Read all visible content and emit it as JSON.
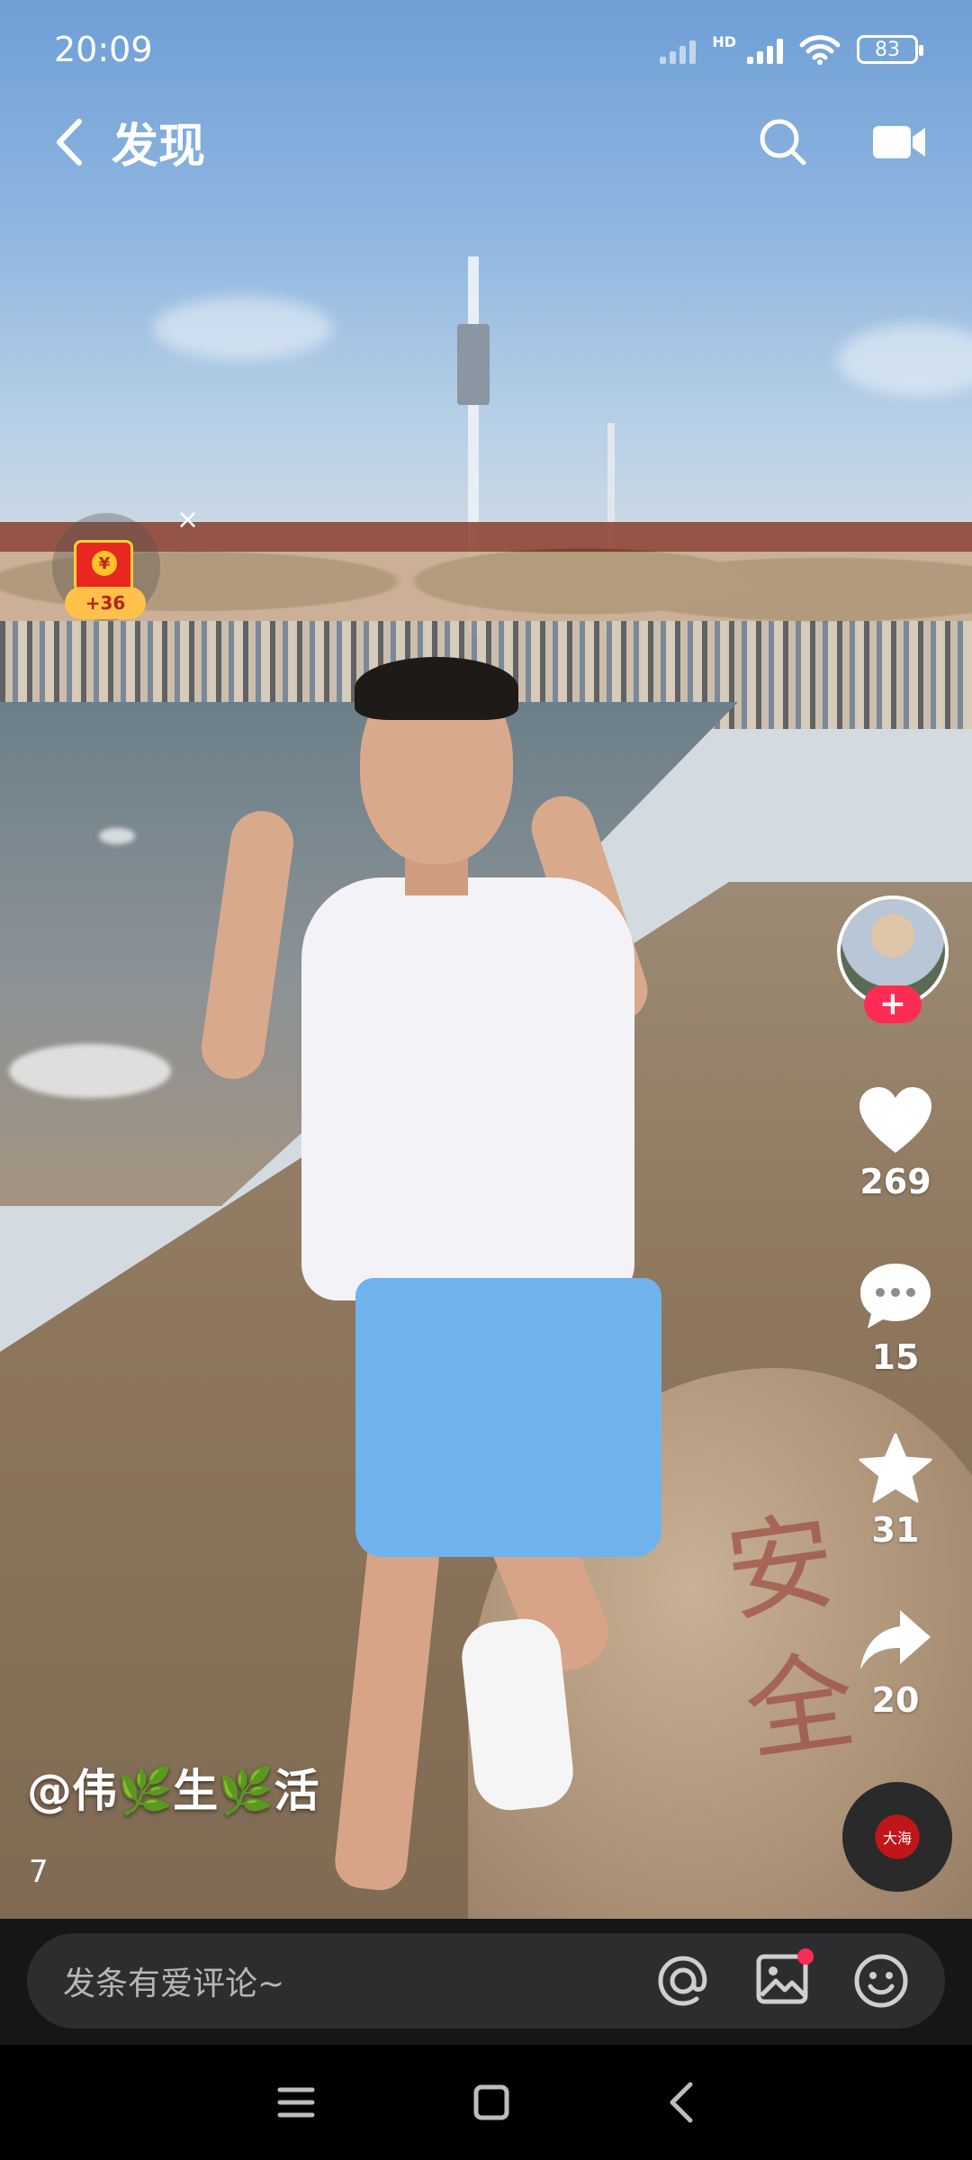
{
  "status_bar": {
    "time": "20:09",
    "network_label": "HD",
    "battery": "83"
  },
  "nav": {
    "title": "发现",
    "back_icon": "chevron-left-icon",
    "search_icon": "search-icon",
    "camera_icon": "video-camera-icon"
  },
  "red_packet": {
    "coin_symbol": "¥",
    "badge": "+36",
    "close": "×"
  },
  "video": {
    "engraving": "安全"
  },
  "actions": {
    "follow": "+",
    "likes": "269",
    "comments": "15",
    "favorites": "31",
    "shares": "20"
  },
  "author": {
    "name": "@伟🌿生🌿活",
    "subtitle": "7"
  },
  "music": {
    "disc_label": "大海"
  },
  "comment_bar": {
    "placeholder": "发条有爱评论~"
  },
  "colors": {
    "accent": "#fe2c55",
    "comment_bar_bg": "#2d2d2f",
    "shorts": "#6fb3ee"
  }
}
